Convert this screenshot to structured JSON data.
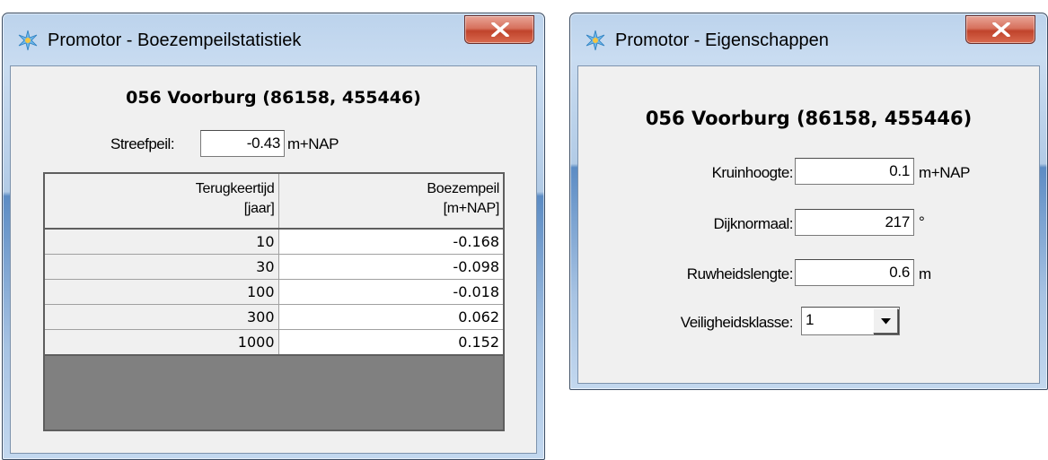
{
  "window1": {
    "title": "Promotor - Boezempeilstatistiek",
    "station": "056 Voorburg (86158, 455446)",
    "streefpeil": {
      "label": "Streefpeil:",
      "value": "-0.43",
      "unit": "m+NAP"
    },
    "table": {
      "headers": [
        {
          "line1": "Terugkeertijd",
          "line2": "[jaar]"
        },
        {
          "line1": "Boezempeil",
          "line2": "[m+NAP]"
        }
      ],
      "rows": [
        {
          "return_period": "10",
          "level": "-0.168"
        },
        {
          "return_period": "30",
          "level": "-0.098"
        },
        {
          "return_period": "100",
          "level": "-0.018"
        },
        {
          "return_period": "300",
          "level": "0.062"
        },
        {
          "return_period": "1000",
          "level": "0.152"
        }
      ]
    }
  },
  "window2": {
    "title": "Promotor - Eigenschappen",
    "station": "056 Voorburg (86158, 455446)",
    "fields": {
      "kruinhoogte": {
        "label": "Kruinhoogte:",
        "value": "0.1",
        "unit": "m+NAP"
      },
      "dijknormaal": {
        "label": "Dijknormaal:",
        "value": "217",
        "unit": "°"
      },
      "ruwheidslengte": {
        "label": "Ruwheidslengte:",
        "value": "0.6",
        "unit": "m"
      },
      "veiligheidsklasse": {
        "label": "Veiligheidsklasse:",
        "value": "1"
      }
    }
  },
  "colors": {
    "close_button": "#c7452d",
    "title_bar": "#b9d1ea",
    "client_bg": "#f0f0f0",
    "grid_empty": "#808080"
  },
  "icons": {
    "app": "promotor-app-icon",
    "close": "close-x-icon",
    "dropdown": "chevron-down-icon"
  }
}
